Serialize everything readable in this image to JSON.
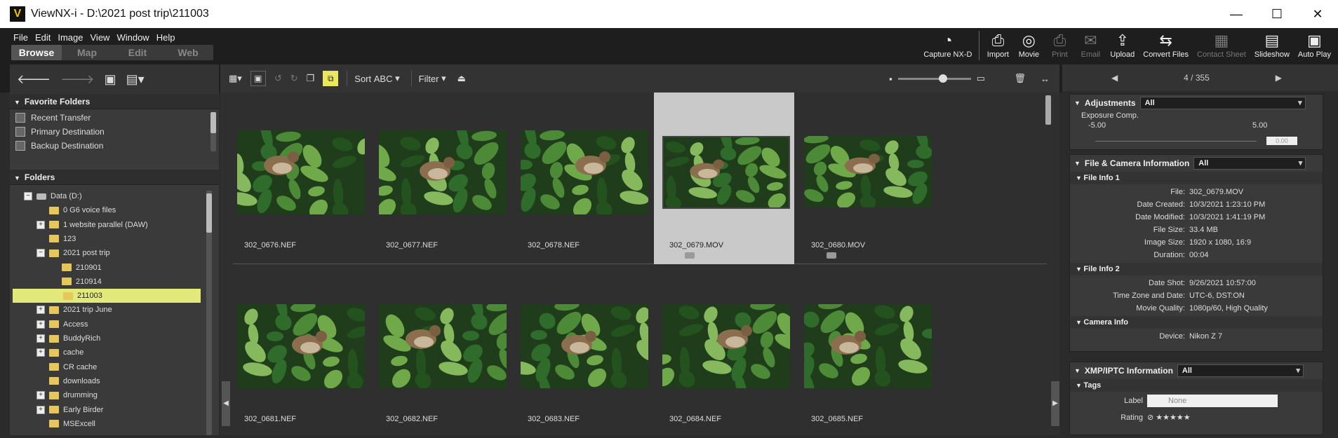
{
  "window": {
    "title": "ViewNX-i - D:\\2021 post trip\\211003",
    "logo": "V",
    "minimize": "—",
    "maximize": "☐",
    "close": "✕"
  },
  "menu": [
    "File",
    "Edit",
    "Image",
    "View",
    "Window",
    "Help"
  ],
  "mode_tabs": [
    {
      "label": "Browse",
      "active": true
    },
    {
      "label": "Map",
      "active": false
    },
    {
      "label": "Edit",
      "active": false
    },
    {
      "label": "Web",
      "active": false
    }
  ],
  "toolbar": [
    {
      "label": "Capture NX-D",
      "icon": "capture-icon",
      "glyph": "◔",
      "disabled": false
    },
    {
      "label": "Import",
      "icon": "import-icon",
      "glyph": "⎙",
      "disabled": false
    },
    {
      "label": "Movie",
      "icon": "movie-icon",
      "glyph": "◎",
      "disabled": false
    },
    {
      "label": "Print",
      "icon": "print-icon",
      "glyph": "⎙",
      "disabled": true
    },
    {
      "label": "Email",
      "icon": "email-icon",
      "glyph": "✉",
      "disabled": true
    },
    {
      "label": "Upload",
      "icon": "upload-icon",
      "glyph": "⇪",
      "disabled": false
    },
    {
      "label": "Convert Files",
      "icon": "convert-icon",
      "glyph": "⇆",
      "disabled": false
    },
    {
      "label": "Contact Sheet",
      "icon": "contact-sheet-icon",
      "glyph": "▦",
      "disabled": true
    },
    {
      "label": "Slideshow",
      "icon": "slideshow-icon",
      "glyph": "▤",
      "disabled": false
    },
    {
      "label": "Auto Play",
      "icon": "auto-play-icon",
      "glyph": "▣",
      "disabled": false
    }
  ],
  "left": {
    "favorites_title": "Favorite Folders",
    "favorites": [
      "Recent Transfer",
      "Primary Destination",
      "Backup Destination"
    ],
    "folders_title": "Folders",
    "tree": [
      {
        "label": "Data (D:)",
        "level": 0,
        "toggle": "−",
        "kind": "drive"
      },
      {
        "label": "0 G6 voice files",
        "level": 1,
        "toggle": "",
        "kind": "folder"
      },
      {
        "label": "1 website parallel (DAW)",
        "level": 1,
        "toggle": "+",
        "kind": "folder"
      },
      {
        "label": "123",
        "level": 1,
        "toggle": "",
        "kind": "folder"
      },
      {
        "label": "2021 post trip",
        "level": 1,
        "toggle": "−",
        "kind": "folder"
      },
      {
        "label": "210901",
        "level": 2,
        "toggle": "",
        "kind": "folder"
      },
      {
        "label": "210914",
        "level": 2,
        "toggle": "",
        "kind": "folder"
      },
      {
        "label": "211003",
        "level": 2,
        "toggle": "",
        "kind": "folder",
        "selected": true
      },
      {
        "label": "2021 trip June",
        "level": 1,
        "toggle": "+",
        "kind": "folder"
      },
      {
        "label": "Access",
        "level": 1,
        "toggle": "+",
        "kind": "folder"
      },
      {
        "label": "BuddyRich",
        "level": 1,
        "toggle": "+",
        "kind": "folder"
      },
      {
        "label": "cache",
        "level": 1,
        "toggle": "+",
        "kind": "folder"
      },
      {
        "label": "CR cache",
        "level": 1,
        "toggle": "",
        "kind": "folder"
      },
      {
        "label": "downloads",
        "level": 1,
        "toggle": "",
        "kind": "folder"
      },
      {
        "label": "drumming",
        "level": 1,
        "toggle": "+",
        "kind": "folder"
      },
      {
        "label": "Early Birder",
        "level": 1,
        "toggle": "+",
        "kind": "folder"
      },
      {
        "label": "MSExcell",
        "level": 1,
        "toggle": "",
        "kind": "folder"
      }
    ]
  },
  "center": {
    "sort_label": "Sort",
    "sort_value": "ABC",
    "filter_label": "Filter",
    "thumbnails": [
      {
        "file": "302_0676.NEF",
        "movie": false,
        "selected": false
      },
      {
        "file": "302_0677.NEF",
        "movie": false,
        "selected": false
      },
      {
        "file": "302_0678.NEF",
        "movie": false,
        "selected": false
      },
      {
        "file": "302_0679.MOV",
        "movie": true,
        "selected": true
      },
      {
        "file": "302_0680.MOV",
        "movie": true,
        "selected": false
      },
      {
        "file": "302_0681.NEF",
        "movie": false,
        "selected": false
      },
      {
        "file": "302_0682.NEF",
        "movie": false,
        "selected": false
      },
      {
        "file": "302_0683.NEF",
        "movie": false,
        "selected": false
      },
      {
        "file": "302_0684.NEF",
        "movie": false,
        "selected": false
      },
      {
        "file": "302_0685.NEF",
        "movie": false,
        "selected": false
      }
    ]
  },
  "right": {
    "counter": "4 / 355",
    "adjustments": {
      "title": "Adjustments",
      "filter": "All",
      "exposure_label": "Exposure Comp.",
      "min": "-5.00",
      "max": "5.00",
      "value": "0.00"
    },
    "file_camera": {
      "title": "File & Camera Information",
      "filter": "All",
      "groups": [
        {
          "title": "File Info 1",
          "rows": [
            {
              "k": "File:",
              "v": "302_0679.MOV"
            },
            {
              "k": "Date Created:",
              "v": "10/3/2021 1:23:10 PM"
            },
            {
              "k": "Date Modified:",
              "v": "10/3/2021 1:41:19 PM"
            },
            {
              "k": "File Size:",
              "v": "33.4 MB"
            },
            {
              "k": "Image Size:",
              "v": "1920 x 1080, 16:9"
            },
            {
              "k": "Duration:",
              "v": "00:04"
            }
          ]
        },
        {
          "title": "File Info 2",
          "rows": [
            {
              "k": "Date Shot:",
              "v": "9/26/2021 10:57:00"
            },
            {
              "k": "Time Zone and Date:",
              "v": "UTC-6, DST:ON"
            },
            {
              "k": "Movie Quality:",
              "v": "1080p/60, High Quality"
            }
          ]
        },
        {
          "title": "Camera Info",
          "rows": [
            {
              "k": "Device:",
              "v": "Nikon Z 7"
            }
          ]
        }
      ]
    },
    "xmp": {
      "title": "XMP/IPTC Information",
      "filter": "All",
      "tags_title": "Tags",
      "label_k": "Label",
      "label_v": "None",
      "rating_k": "Rating",
      "rating_v": "⊘ ★★★★★"
    }
  }
}
